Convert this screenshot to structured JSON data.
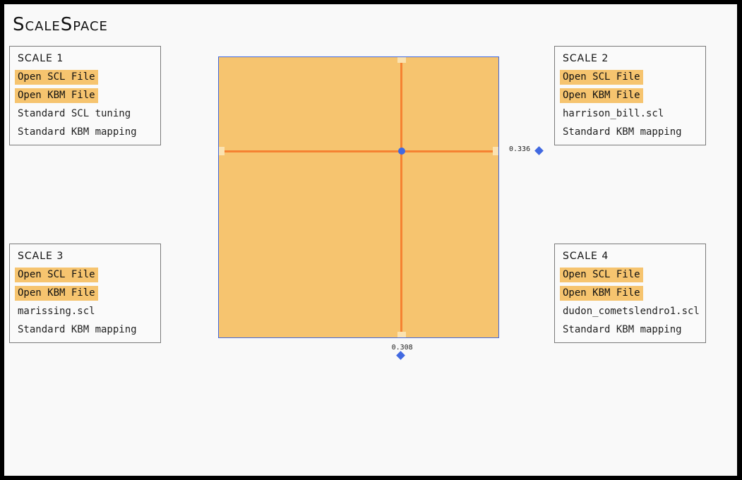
{
  "app": {
    "title": "ScaleSpace"
  },
  "panels": [
    {
      "title": "Scale 1",
      "open_scl": "Open SCL File",
      "open_kbm": "Open KBM File",
      "scl_name": "Standard SCL tuning",
      "kbm_name": "Standard KBM mapping"
    },
    {
      "title": "Scale 2",
      "open_scl": "Open SCL File",
      "open_kbm": "Open KBM File",
      "scl_name": "harrison_bill.scl",
      "kbm_name": "Standard KBM mapping"
    },
    {
      "title": "Scale 3",
      "open_scl": "Open SCL File",
      "open_kbm": "Open KBM File",
      "scl_name": "marissing.scl",
      "kbm_name": "Standard KBM mapping"
    },
    {
      "title": "Scale 4",
      "open_scl": "Open SCL File",
      "open_kbm": "Open KBM File",
      "scl_name": "dudon_cometslendro1.scl",
      "kbm_name": "Standard KBM mapping"
    }
  ],
  "xy_pad": {
    "x_value": 0.653,
    "y_value": 0.336,
    "x_readout": "0.308",
    "y_readout": "0.336"
  },
  "colors": {
    "accent": "#f6c46f",
    "crosshair": "#f58232",
    "handle": "#4169e1"
  }
}
